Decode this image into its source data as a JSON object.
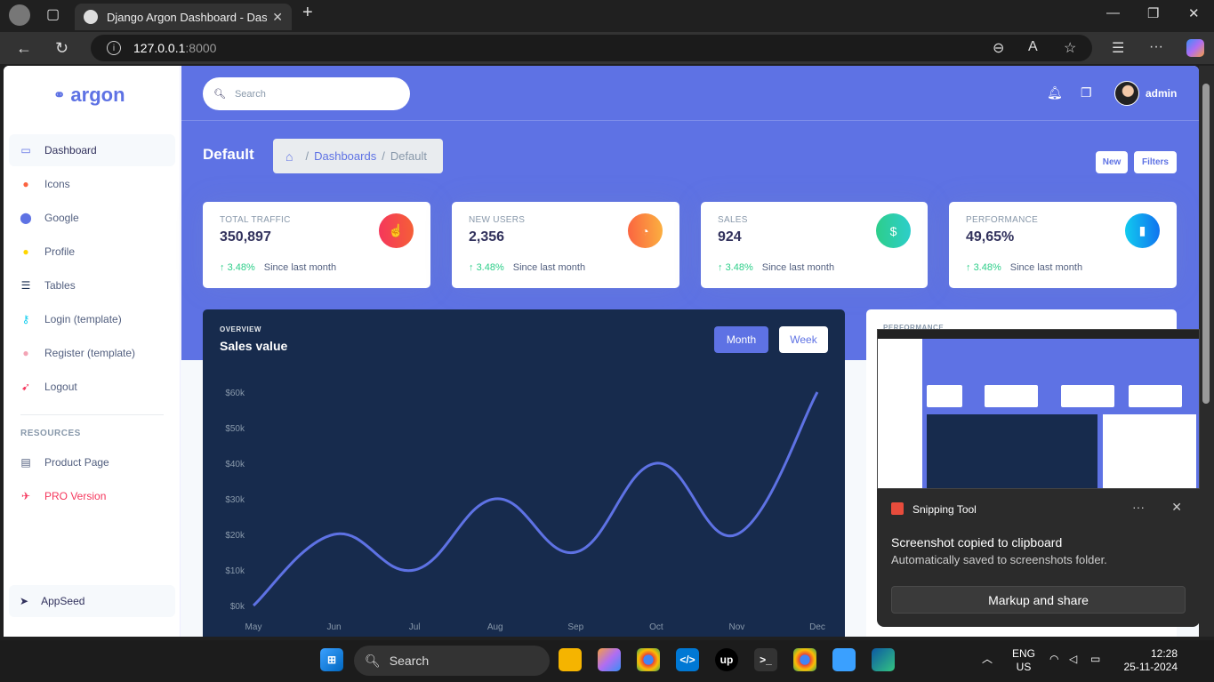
{
  "browser": {
    "tab_title": "Django Argon Dashboard - Dashb",
    "url_host": "127.0.0.1",
    "url_port": ":8000"
  },
  "sidebar": {
    "logo": "argon",
    "items": [
      {
        "label": "Dashboard",
        "icon": "tv-icon",
        "color": "#5e72e4"
      },
      {
        "label": "Icons",
        "icon": "planet-icon",
        "color": "#fb6340"
      },
      {
        "label": "Google",
        "icon": "pin-icon",
        "color": "#5e72e4"
      },
      {
        "label": "Profile",
        "icon": "user-icon",
        "color": "#ffd600"
      },
      {
        "label": "Tables",
        "icon": "bullet-list-icon",
        "color": "#172b4d"
      },
      {
        "label": "Login (template)",
        "icon": "key-icon",
        "color": "#11cdef"
      },
      {
        "label": "Register (template)",
        "icon": "circle-icon",
        "color": "#f3a4b5"
      },
      {
        "label": "Logout",
        "icon": "run-icon",
        "color": "#f5365c"
      }
    ],
    "resources_heading": "RESOURCES",
    "resources": [
      {
        "label": "Product Page",
        "icon": "archive-icon"
      },
      {
        "label": "PRO Version",
        "icon": "spaceship-icon"
      }
    ],
    "footer": "AppSeed"
  },
  "header": {
    "search_placeholder": "Search",
    "user_name": "admin",
    "page_title": "Default",
    "breadcrumb": {
      "parent": "Dashboards",
      "current": "Default",
      "separator": "/"
    },
    "buttons": {
      "new": "New",
      "filters": "Filters"
    }
  },
  "stats": [
    {
      "label": "TOTAL TRAFFIC",
      "value": "350,897",
      "change": "3.48%",
      "note": "Since last month",
      "color": "#f5365c",
      "icon": "pointer-icon"
    },
    {
      "label": "NEW USERS",
      "value": "2,356",
      "change": "3.48%",
      "note": "Since last month",
      "color": "#fb6340",
      "icon": "chart-pie-icon"
    },
    {
      "label": "SALES",
      "value": "924",
      "change": "3.48%",
      "note": "Since last month",
      "color": "#2dce89",
      "icon": "money-coins-icon"
    },
    {
      "label": "PERFORMANCE",
      "value": "49,65%",
      "change": "3.48%",
      "note": "Since last month",
      "color": "#11cdef",
      "icon": "chart-bar-icon"
    }
  ],
  "overview": {
    "kicker": "OVERVIEW",
    "title": "Sales value",
    "toggle": {
      "month": "Month",
      "week": "Week"
    }
  },
  "perf_card": {
    "kicker": "PERFORMANCE"
  },
  "chart_data": {
    "type": "line",
    "categories": [
      "May",
      "Jun",
      "Jul",
      "Aug",
      "Sep",
      "Oct",
      "Nov",
      "Dec"
    ],
    "series": [
      {
        "values": [
          0,
          20,
          10,
          30,
          15,
          40,
          20,
          60
        ]
      }
    ],
    "y_ticks": [
      "$0k",
      "$10k",
      "$20k",
      "$30k",
      "$40k",
      "$50k",
      "$60k"
    ],
    "ylim": [
      0,
      60
    ],
    "line_color": "#5e72e4",
    "grid": false
  },
  "toast": {
    "app_name": "Snipping Tool",
    "heading": "Screenshot copied to clipboard",
    "body": "Automatically saved to screenshots folder.",
    "button": "Markup and share",
    "more": "···",
    "close": "✕"
  },
  "taskbar": {
    "search": "Search",
    "lang": "ENG",
    "region": "US",
    "time": "12:28",
    "date": "25-11-2024"
  }
}
